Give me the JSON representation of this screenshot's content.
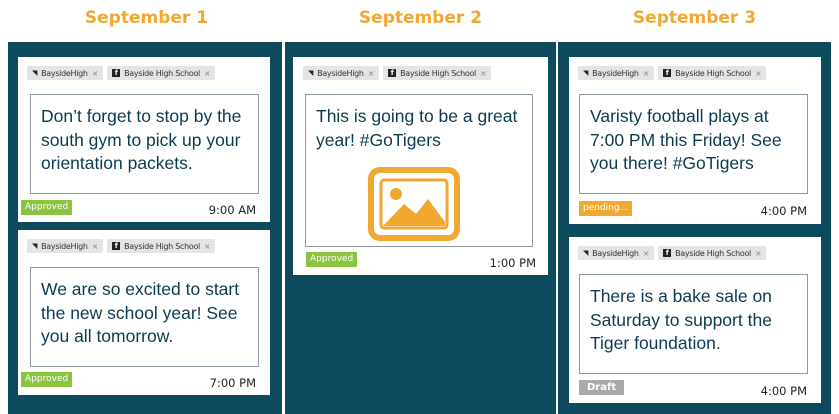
{
  "days": [
    {
      "header": "September 1",
      "posts": [
        {
          "accounts": [
            {
              "type": "twitter",
              "handle": "BaysideHigh"
            },
            {
              "type": "facebook",
              "handle": "Bayside High School"
            }
          ],
          "text": "Don’t forget to stop by the south gym to pick up your orientation packets.",
          "status": "Approved",
          "time": "9:00 AM"
        },
        {
          "accounts": [
            {
              "type": "twitter",
              "handle": "BaysideHigh"
            },
            {
              "type": "facebook",
              "handle": "Bayside High School"
            }
          ],
          "text": "We are so excited to start the new school year! See you all tomorrow.",
          "status": "Approved",
          "time": "7:00 PM"
        }
      ]
    },
    {
      "header": "September 2",
      "posts": [
        {
          "accounts": [
            {
              "type": "twitter",
              "handle": "BaysideHigh"
            },
            {
              "type": "facebook",
              "handle": "Bayside High School"
            }
          ],
          "text": "This is going to be a great year! #GoTigers",
          "image_icon": "image-placeholder-icon",
          "status": "Approved",
          "time": "1:00 PM"
        }
      ]
    },
    {
      "header": "September 3",
      "posts": [
        {
          "accounts": [
            {
              "type": "twitter",
              "handle": "BaysideHigh"
            },
            {
              "type": "facebook",
              "handle": "Bayside High School"
            }
          ],
          "text": "Varisty football plays at 7:00 PM this Friday! See you there! #GoTigers",
          "status": "pending...",
          "time": "4:00 PM"
        },
        {
          "accounts": [
            {
              "type": "twitter",
              "handle": "BaysideHigh"
            },
            {
              "type": "facebook",
              "handle": "Bayside High School"
            }
          ],
          "text": "There is a bake sale on Saturday to support the Tiger foundation.",
          "status": "Draft",
          "time": "4:00 PM"
        }
      ]
    }
  ],
  "icons": {
    "twitter": "twitter-bird-icon",
    "facebook": "facebook-f-icon",
    "remove": "remove-x-icon"
  },
  "colors": {
    "header": "#f0a830",
    "column_bg": "#0d4a5e",
    "approved": "#8bc43f",
    "pending": "#f0a830",
    "draft": "#a9a9a9",
    "text": "#0d3a52"
  },
  "glyphs": {
    "twitter": "❧",
    "facebook": "f",
    "remove": "×"
  }
}
